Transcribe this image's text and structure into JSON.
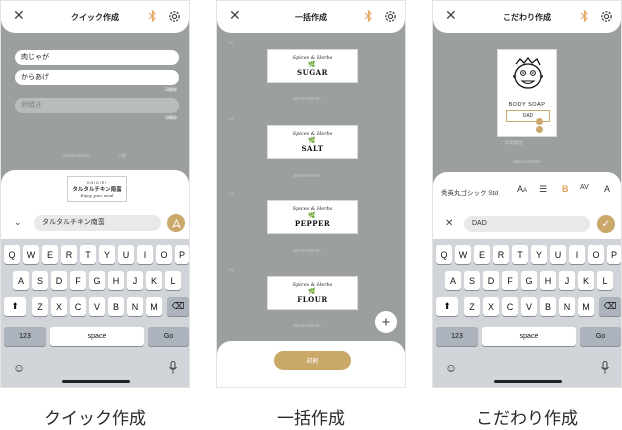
{
  "screens": [
    {
      "title": "クイック作成",
      "caption": "クイック作成",
      "lines": [
        {
          "text": "肉じゃが",
          "placeholder": false
        },
        {
          "text": "からあげ",
          "placeholder": false
        },
        {
          "text": "卵焼き",
          "placeholder": true
        }
      ],
      "side_labels": [
        "印刷枠",
        "印刷枠"
      ],
      "dims_text": "24mm×36mm",
      "count_text": "2個",
      "preview": {
        "top": "ONIGIRI",
        "main": "タルタルチキン南蛮",
        "sub": "Enjoy your meal"
      },
      "input_value": "タルタルチキン南蛮"
    },
    {
      "title": "一括作成",
      "caption": "一括作成",
      "labels": [
        {
          "no": "01",
          "brand": "Spices & Herbs",
          "name": "SUGAR",
          "dims": "30mm×50mm"
        },
        {
          "no": "02",
          "brand": "Spices & Herbs",
          "name": "SALT",
          "dims": "30mm×50mm"
        },
        {
          "no": "03",
          "brand": "Spices & Herbs",
          "name": "PEPPER",
          "dims": "30mm×50mm"
        },
        {
          "no": "04",
          "brand": "Spices & Herbs",
          "name": "FLOUR",
          "dims": "30mm×50mm"
        }
      ],
      "print_button": "印刷"
    },
    {
      "title": "こだわり作成",
      "caption": "こだわり作成",
      "label": {
        "title": "BODY SOAP",
        "name": "DAD"
      },
      "preview_note": "印刷範囲",
      "dims_text": "30mm×50mm",
      "font_name": "秀英丸ゴシック Std",
      "input_value": "DAD"
    }
  ],
  "keyboard": {
    "row1": [
      "Q",
      "W",
      "E",
      "R",
      "T",
      "Y",
      "U",
      "I",
      "O",
      "P"
    ],
    "row2": [
      "A",
      "S",
      "D",
      "F",
      "G",
      "H",
      "J",
      "K",
      "L"
    ],
    "row3": [
      "Z",
      "X",
      "C",
      "V",
      "B",
      "N",
      "M"
    ],
    "num_key": "123",
    "space_key": "space",
    "go_key": "Go"
  },
  "colors": {
    "accent": "#c9a86a",
    "bluetooth": "#e0a25a",
    "background": "#9b9fa0",
    "keyboard": "#d1d4d9"
  },
  "icons": [
    "close-icon",
    "bluetooth-icon",
    "gear-icon",
    "chevron-down-icon",
    "send-icon",
    "emoji-icon",
    "microphone-icon",
    "shift-icon",
    "backspace-icon",
    "plus-icon",
    "check-icon"
  ]
}
